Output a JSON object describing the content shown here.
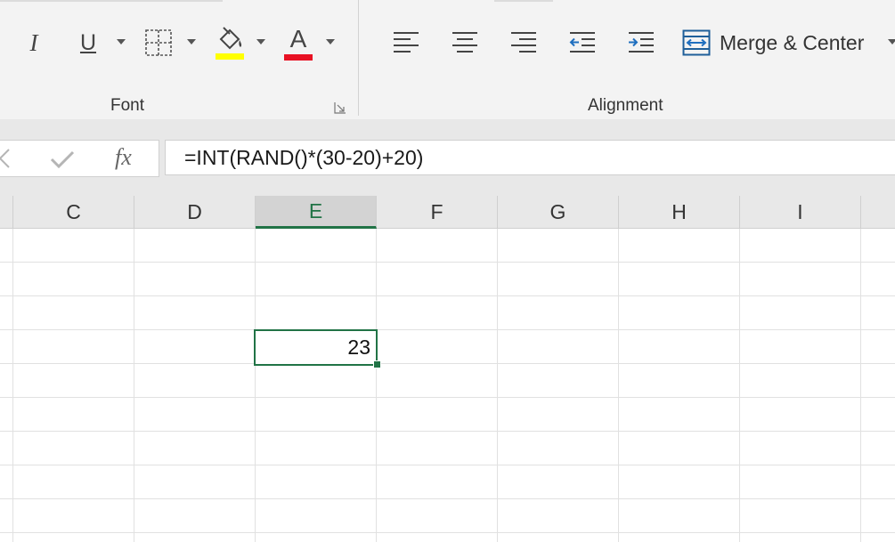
{
  "ribbon": {
    "font_group": {
      "label": "Font",
      "italic_glyph": "I",
      "underline_glyph": "U",
      "font_color_glyph": "A",
      "fill_highlight_color": "#ffff00",
      "font_color": "#e81123"
    },
    "alignment_group": {
      "label": "Alignment",
      "merge_label": "Merge & Center"
    }
  },
  "formula_bar": {
    "fx_label": "fx",
    "formula": "=INT(RAND()*(30-20)+20)"
  },
  "grid": {
    "columns": [
      "C",
      "D",
      "E",
      "F",
      "G",
      "H",
      "I"
    ],
    "selected_column": "E",
    "active_cell": {
      "column": "E",
      "value": "23"
    }
  },
  "colors": {
    "accent": "#217346",
    "ribbon_bg": "#f3f3f3",
    "header_bg": "#e8e8e8"
  }
}
